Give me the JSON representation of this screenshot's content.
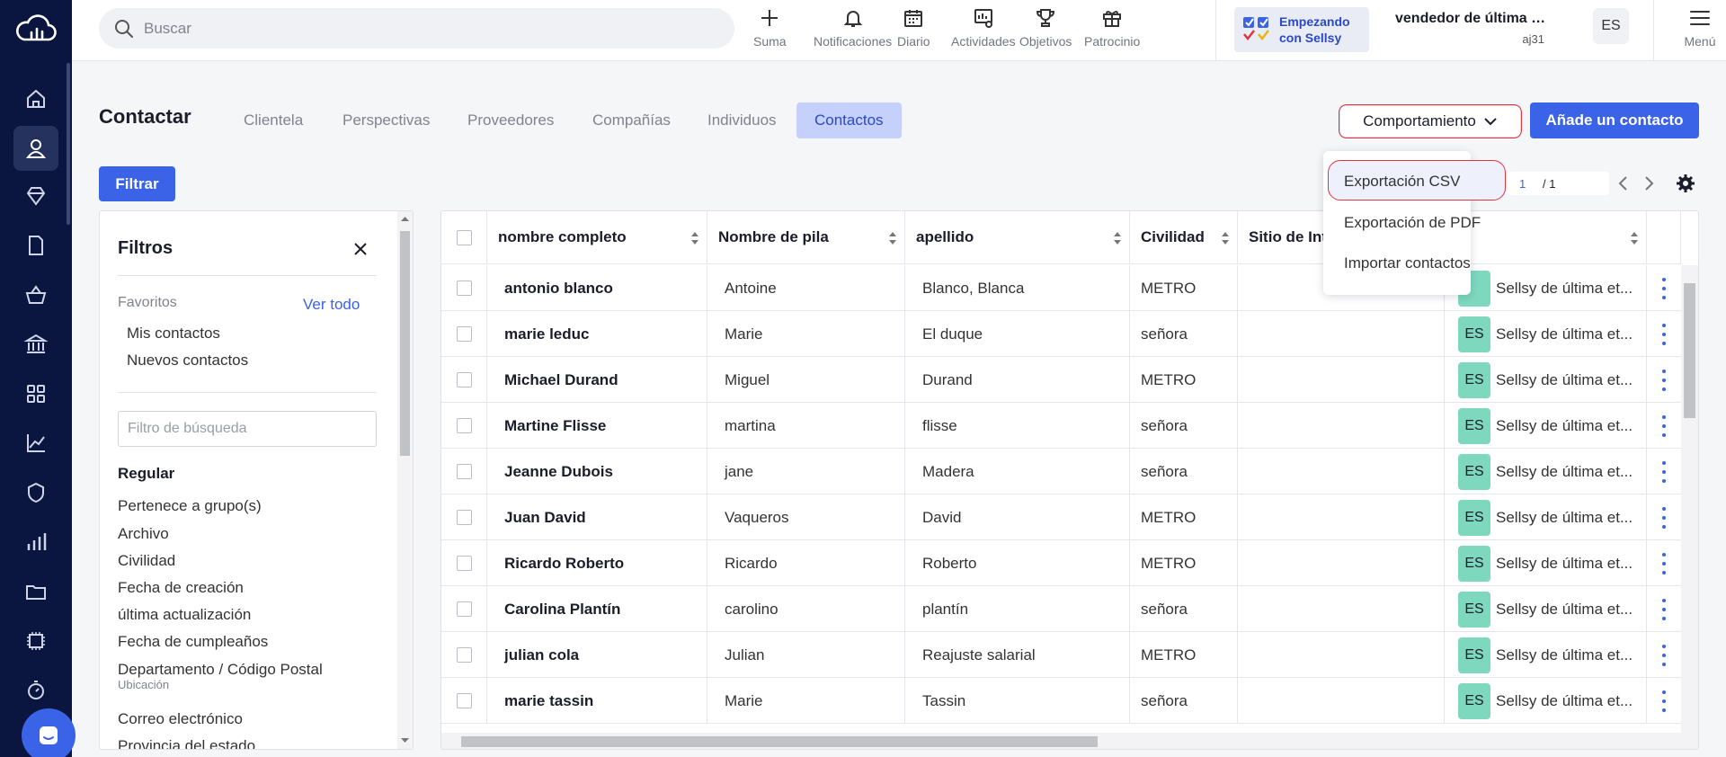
{
  "topbar": {
    "search_placeholder": "Buscar",
    "tools": [
      {
        "label": "Suma",
        "icon": "plus-icon"
      },
      {
        "label": "Notificaciones",
        "icon": "bell-icon"
      },
      {
        "label": "Diario",
        "icon": "calendar-icon"
      },
      {
        "label": "Actividades",
        "icon": "activities-icon"
      },
      {
        "label": "Objetivos",
        "icon": "trophy-icon"
      },
      {
        "label": "Patrocinio",
        "icon": "gift-icon"
      }
    ],
    "onboarding_label": "Empezando con Sellsy",
    "user_name": "vendedor de última eta...",
    "user_code": "aj31",
    "avatar_initials": "ES",
    "menu_label": "Menú"
  },
  "sidebar": {
    "items": [
      "home-icon",
      "contacts-icon",
      "diamond-icon",
      "document-icon",
      "basket-icon",
      "bank-icon",
      "apps-grid-icon",
      "chart-line-icon",
      "shield-icon",
      "bar-chart-icon",
      "folder-icon",
      "chip-icon",
      "stopwatch-icon"
    ],
    "active_index": 1
  },
  "page": {
    "title": "Contactar",
    "tabs": [
      "Clientela",
      "Perspectivas",
      "Proveedores",
      "Compañías",
      "Individuos",
      "Contactos"
    ],
    "active_tab": "Contactos",
    "behavior_button": "Comportamiento",
    "add_button": "Añade un contacto",
    "filter_button": "Filtrar",
    "pager": {
      "current": "1",
      "total": "/ 1"
    }
  },
  "dropdown": {
    "items": [
      "Exportación CSV",
      "Exportación de PDF",
      "Importar contactos"
    ],
    "highlighted": "Exportación CSV"
  },
  "filters": {
    "title": "Filtros",
    "favorites_label": "Favoritos",
    "see_all": "Ver todo",
    "favorites": [
      "Mis contactos",
      "Nuevos contactos"
    ],
    "search_placeholder": "Filtro de búsqueda",
    "group_label": "Regular",
    "items": [
      "Pertenece a grupo(s)",
      "Archivo",
      "Civilidad",
      "Fecha de creación",
      "última actualización",
      "Fecha de cumpleaños",
      "Departamento / Código Postal",
      "Correo electrónico",
      "Provincia del estado"
    ],
    "location_hint": "Ubicación"
  },
  "table": {
    "columns": [
      "nombre completo",
      "Nombre de pila",
      "apellido",
      "Civilidad",
      "Sitio de Inte"
    ],
    "rows": [
      {
        "full": "antonio blanco",
        "first": "Antoine",
        "last": "Blanco, Blanca",
        "civ": "METRO",
        "owner": "Sellsy de última et...",
        "badge": ""
      },
      {
        "full": "marie leduc",
        "first": "Marie",
        "last": "El duque",
        "civ": "señora",
        "owner": "Sellsy de última et...",
        "badge": "ES"
      },
      {
        "full": "Michael Durand",
        "first": "Miguel",
        "last": "Durand",
        "civ": "METRO",
        "owner": "Sellsy de última et...",
        "badge": "ES"
      },
      {
        "full": "Martine Flisse",
        "first": "martina",
        "last": "flisse",
        "civ": "señora",
        "owner": "Sellsy de última et...",
        "badge": "ES"
      },
      {
        "full": "Jeanne Dubois",
        "first": "jane",
        "last": "Madera",
        "civ": "señora",
        "owner": "Sellsy de última et...",
        "badge": "ES"
      },
      {
        "full": "Juan David",
        "first": "Vaqueros",
        "last": "David",
        "civ": "METRO",
        "owner": "Sellsy de última et...",
        "badge": "ES"
      },
      {
        "full": "Ricardo Roberto",
        "first": "Ricardo",
        "last": "Roberto",
        "civ": "METRO",
        "owner": "Sellsy de última et...",
        "badge": "ES"
      },
      {
        "full": "Carolina Plantín",
        "first": "carolino",
        "last": "plantín",
        "civ": "señora",
        "owner": "Sellsy de última et...",
        "badge": "ES"
      },
      {
        "full": "julian cola",
        "first": "Julian",
        "last": "Reajuste salarial",
        "civ": "METRO",
        "owner": "Sellsy de última et...",
        "badge": "ES"
      },
      {
        "full": "marie tassin",
        "first": "Marie",
        "last": "Tassin",
        "civ": "señora",
        "owner": "Sellsy de última et...",
        "badge": "ES"
      }
    ]
  },
  "colors": {
    "primary": "#3b63e8",
    "sidebar": "#0a1640",
    "badge": "#7ed8bd",
    "highlight_ring": "#e0343f"
  }
}
